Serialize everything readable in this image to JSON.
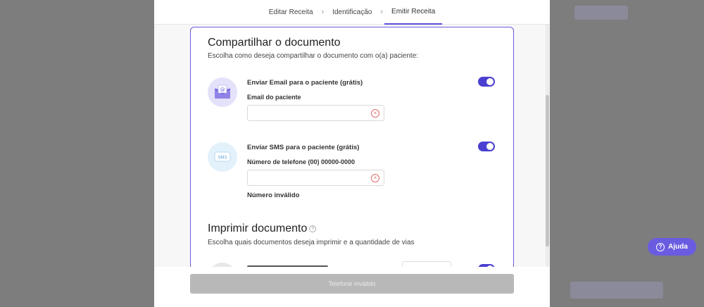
{
  "stepper": {
    "steps": [
      "Editar Receita",
      "Identificação",
      "Emitir Receita"
    ],
    "active_index": 2
  },
  "share": {
    "title": "Compartilhar o documento",
    "subtitle": "Escolha como deseja compartilhar o documento com o(a) paciente:",
    "email": {
      "option_label": "Enviar Email para o paciente (grátis)",
      "field_label": "Email do paciente",
      "value": "",
      "enabled": true
    },
    "sms": {
      "avatar_text": "SMS",
      "option_label": "Enviar SMS para o paciente (grátis)",
      "field_label": "Número de telefone (00) 00000-0000",
      "value": "",
      "error": "Número inválido",
      "enabled": true
    }
  },
  "print": {
    "title": "Imprimir documento",
    "subtitle": "Escolha quais documentos deseja imprimir e a quantidade de vias"
  },
  "footer": {
    "submit_label": "Telefone inválido"
  },
  "help": {
    "label": "Ajuda"
  },
  "colors": {
    "accent": "#5b4fd6",
    "toggle_on": "#4a3fd0",
    "error": "#e06a6a"
  }
}
